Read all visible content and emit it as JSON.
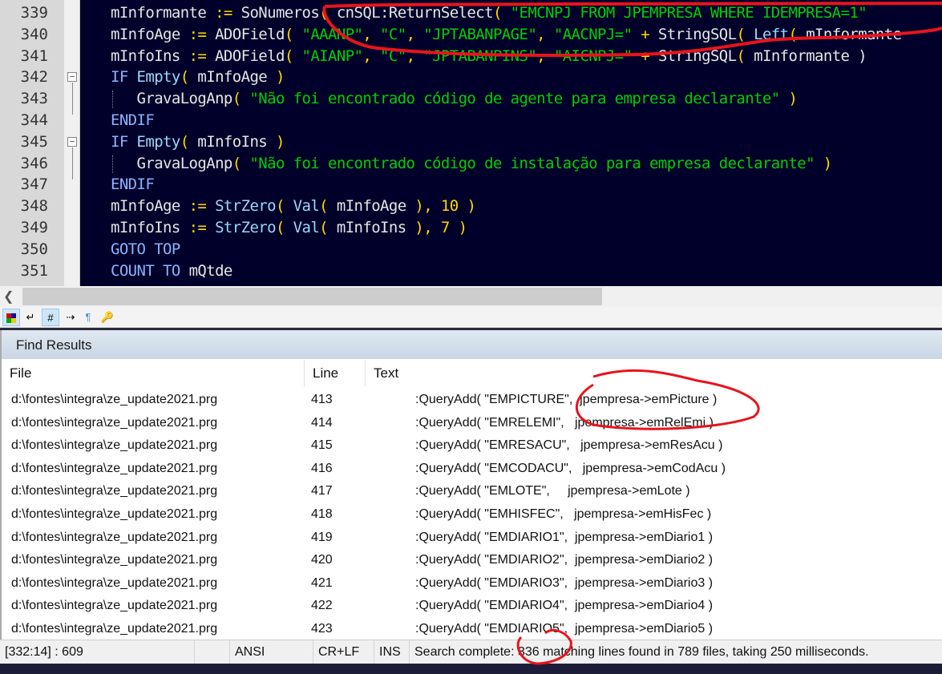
{
  "editor": {
    "lines": [
      {
        "n": "339",
        "tokens": [
          [
            "id",
            "mInformante "
          ],
          [
            "op",
            ":="
          ],
          [
            "id",
            " SoNumeros"
          ],
          [
            "op",
            "("
          ],
          [
            "id",
            " cnSQL:ReturnSelect"
          ],
          [
            "op",
            "("
          ],
          [
            "str",
            " \"EMCNPJ FROM JPEMPRESA WHERE IDEMPRESA=1\""
          ]
        ]
      },
      {
        "n": "340",
        "tokens": [
          [
            "id",
            "mInfoAge "
          ],
          [
            "op",
            ":="
          ],
          [
            "id",
            " ADOField"
          ],
          [
            "op",
            "("
          ],
          [
            "str",
            " \"AAANP\""
          ],
          [
            "op",
            ","
          ],
          [
            "str",
            " \"C\""
          ],
          [
            "op",
            ","
          ],
          [
            "str",
            " \"JPTABANPAGE\""
          ],
          [
            "op",
            ","
          ],
          [
            "str",
            " \"AACNPJ=\""
          ],
          [
            "op",
            " +"
          ],
          [
            "id",
            " StringSQL"
          ],
          [
            "op",
            "("
          ],
          [
            "fn",
            " Left"
          ],
          [
            "op",
            "("
          ],
          [
            "id",
            " mInformante"
          ]
        ]
      },
      {
        "n": "341",
        "tokens": [
          [
            "id",
            "mInfoIns "
          ],
          [
            "op",
            ":="
          ],
          [
            "id",
            " ADOField"
          ],
          [
            "op",
            "("
          ],
          [
            "str",
            " \"AIANP\""
          ],
          [
            "op",
            ","
          ],
          [
            "str",
            " \"C\""
          ],
          [
            "op",
            ","
          ],
          [
            "str",
            " \"JPTABANPINS\""
          ],
          [
            "op",
            ","
          ],
          [
            "str",
            " \"AICNPJ=\""
          ],
          [
            "op",
            " +"
          ],
          [
            "id",
            " StringSQL"
          ],
          [
            "op",
            "("
          ],
          [
            "id",
            " mInformante )"
          ]
        ]
      },
      {
        "n": "342",
        "tokens": [
          [
            "kw",
            "IF "
          ],
          [
            "fn",
            "Empty"
          ],
          [
            "op",
            "("
          ],
          [
            "id",
            " mInfoAge "
          ],
          [
            "op",
            ")"
          ]
        ]
      },
      {
        "n": "343",
        "tokens": [
          [
            "id",
            "   GravaLogAnp"
          ],
          [
            "op",
            "("
          ],
          [
            "str",
            " \"Não foi encontrado código de agente para empresa declarante\""
          ],
          [
            "op",
            " )"
          ]
        ]
      },
      {
        "n": "344",
        "tokens": [
          [
            "kw",
            "ENDIF"
          ]
        ]
      },
      {
        "n": "345",
        "tokens": [
          [
            "kw",
            "IF "
          ],
          [
            "fn",
            "Empty"
          ],
          [
            "op",
            "("
          ],
          [
            "id",
            " mInfoIns "
          ],
          [
            "op",
            ")"
          ]
        ]
      },
      {
        "n": "346",
        "tokens": [
          [
            "id",
            "   GravaLogAnp"
          ],
          [
            "op",
            "("
          ],
          [
            "str",
            " \"Não foi encontrado código de instalação para empresa declarante\""
          ],
          [
            "op",
            " )"
          ]
        ]
      },
      {
        "n": "347",
        "tokens": [
          [
            "kw",
            "ENDIF"
          ]
        ]
      },
      {
        "n": "348",
        "tokens": [
          [
            "id",
            "mInfoAge "
          ],
          [
            "op",
            ":="
          ],
          [
            "fn",
            " StrZero"
          ],
          [
            "op",
            "("
          ],
          [
            "fn",
            " Val"
          ],
          [
            "op",
            "("
          ],
          [
            "id",
            " mInfoAge "
          ],
          [
            "op",
            "),"
          ],
          [
            "num",
            " 10"
          ],
          [
            "op",
            " )"
          ]
        ]
      },
      {
        "n": "349",
        "tokens": [
          [
            "id",
            "mInfoIns "
          ],
          [
            "op",
            ":="
          ],
          [
            "fn",
            " StrZero"
          ],
          [
            "op",
            "("
          ],
          [
            "fn",
            " Val"
          ],
          [
            "op",
            "("
          ],
          [
            "id",
            " mInfoIns "
          ],
          [
            "op",
            "),"
          ],
          [
            "num",
            " 7"
          ],
          [
            "op",
            " )"
          ]
        ]
      },
      {
        "n": "350",
        "tokens": [
          [
            "kw",
            "GOTO TOP"
          ]
        ]
      },
      {
        "n": "351",
        "tokens": [
          [
            "kw",
            "COUNT TO "
          ],
          [
            "id",
            "mQtde"
          ]
        ]
      }
    ]
  },
  "toolbar": {
    "icons": [
      "color-scheme-icon",
      "word-wrap-icon",
      "line-numbers-icon",
      "show-tabs-icon",
      "show-paragraph-icon",
      "key-icon"
    ]
  },
  "find_results": {
    "title": "Find Results",
    "columns": [
      "File",
      "Line",
      "Text"
    ],
    "rows": [
      {
        "file": "d:\\fontes\\integra\\ze_update2021.prg",
        "line": "413",
        "text": ":QueryAdd( \"EMPICTURE\",  jpempresa->emPicture )"
      },
      {
        "file": "d:\\fontes\\integra\\ze_update2021.prg",
        "line": "414",
        "text": ":QueryAdd( \"EMRELEMI\",   jpempresa->emRelEmi )"
      },
      {
        "file": "d:\\fontes\\integra\\ze_update2021.prg",
        "line": "415",
        "text": ":QueryAdd( \"EMRESACU\",   jpempresa->emResAcu )"
      },
      {
        "file": "d:\\fontes\\integra\\ze_update2021.prg",
        "line": "416",
        "text": ":QueryAdd( \"EMCODACU\",   jpempresa->emCodAcu )"
      },
      {
        "file": "d:\\fontes\\integra\\ze_update2021.prg",
        "line": "417",
        "text": ":QueryAdd( \"EMLOTE\",     jpempresa->emLote )"
      },
      {
        "file": "d:\\fontes\\integra\\ze_update2021.prg",
        "line": "418",
        "text": ":QueryAdd( \"EMHISFEC\",   jpempresa->emHisFec )"
      },
      {
        "file": "d:\\fontes\\integra\\ze_update2021.prg",
        "line": "419",
        "text": ":QueryAdd( \"EMDIARIO1\",  jpempresa->emDiario1 )"
      },
      {
        "file": "d:\\fontes\\integra\\ze_update2021.prg",
        "line": "420",
        "text": ":QueryAdd( \"EMDIARIO2\",  jpempresa->emDiario2 )"
      },
      {
        "file": "d:\\fontes\\integra\\ze_update2021.prg",
        "line": "421",
        "text": ":QueryAdd( \"EMDIARIO3\",  jpempresa->emDiario3 )"
      },
      {
        "file": "d:\\fontes\\integra\\ze_update2021.prg",
        "line": "422",
        "text": ":QueryAdd( \"EMDIARIO4\",  jpempresa->emDiario4 )"
      },
      {
        "file": "d:\\fontes\\integra\\ze_update2021.prg",
        "line": "423",
        "text": ":QueryAdd( \"EMDIARIO5\",  jpempresa->emDiario5 )"
      }
    ]
  },
  "status": {
    "position": "[332:14] : 609",
    "encoding": "ANSI",
    "line_ending": "CR+LF",
    "mode": "INS",
    "message": "Search complete: 336 matching lines found in 789 files, taking 250 milliseconds."
  }
}
